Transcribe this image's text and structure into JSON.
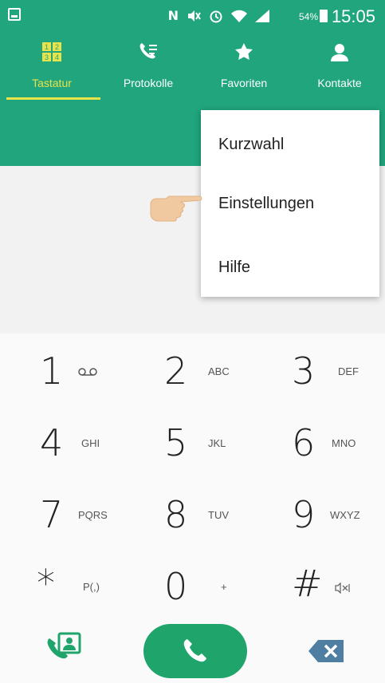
{
  "status": {
    "network": "N",
    "battery": "54%",
    "time": "15:05"
  },
  "tabs": [
    {
      "label": "Tastatur",
      "icon": "dialpad-icon",
      "active": true
    },
    {
      "label": "Protokolle",
      "icon": "call-log-icon",
      "active": false
    },
    {
      "label": "Favoriten",
      "icon": "star-icon",
      "active": false
    },
    {
      "label": "Kontakte",
      "icon": "contact-icon",
      "active": false
    }
  ],
  "tab_icons": {
    "dialpad": [
      "1",
      "2",
      "3",
      "4"
    ]
  },
  "menu": {
    "items": [
      "Kurzwahl",
      "Einstellungen",
      "Hilfe"
    ]
  },
  "keypad": {
    "keys": [
      {
        "num": "1",
        "letters": ""
      },
      {
        "num": "2",
        "letters": "ABC"
      },
      {
        "num": "3",
        "letters": "DEF"
      },
      {
        "num": "4",
        "letters": "GHI"
      },
      {
        "num": "5",
        "letters": "JKL"
      },
      {
        "num": "6",
        "letters": "MNO"
      },
      {
        "num": "7",
        "letters": "PQRS"
      },
      {
        "num": "8",
        "letters": "TUV"
      },
      {
        "num": "9",
        "letters": "WXYZ"
      },
      {
        "num": "*",
        "letters": "P(,)"
      },
      {
        "num": "0",
        "letters": "+"
      },
      {
        "num": "#",
        "letters": ""
      }
    ]
  },
  "colors": {
    "primary": "#20a57c",
    "accent": "#e8e34b",
    "call": "#1fa46b",
    "delete": "#4e7fa3"
  }
}
